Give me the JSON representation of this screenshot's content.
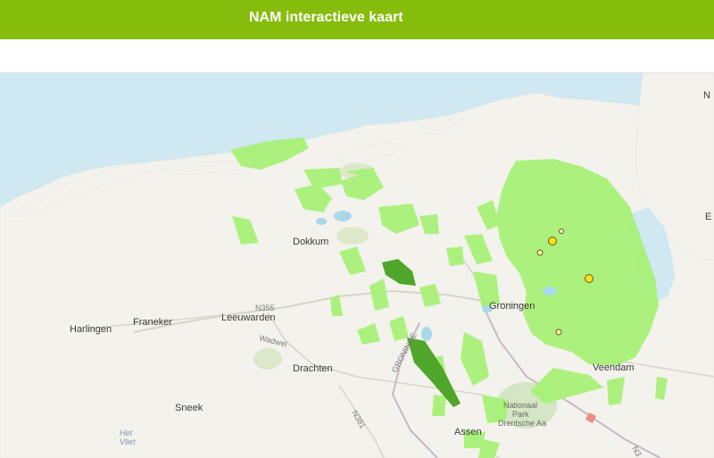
{
  "header": {
    "title": "NAM interactieve kaart"
  },
  "map": {
    "labels": {
      "dokkum": "Dokkum",
      "harlingen": "Harlingen",
      "franeker": "Franeker",
      "leeuwarden": "Leeuwarden",
      "drachten": "Drachten",
      "sneek": "Sneek",
      "groningen": "Groningen",
      "veendam": "Veendam",
      "assen": "Assen",
      "n355": "N355",
      "n381": "N381",
      "wadweg": "Wadwei",
      "groningen_road": "GRONINGE",
      "park_line1": "Nationaal",
      "park_line2": "Park",
      "park_line3": "Drentsche Aa",
      "het_vliet_1": "Het",
      "het_vliet_2": "Vliet",
      "edge_n": "N",
      "edge_e": "E",
      "edge_n2": "N3"
    },
    "colors": {
      "water": "#cfe8f2",
      "land": "#f3f2ec",
      "concession_light": "#a8f078",
      "concession_dark": "#4fa62a",
      "earthquake": "#f4e017"
    }
  }
}
